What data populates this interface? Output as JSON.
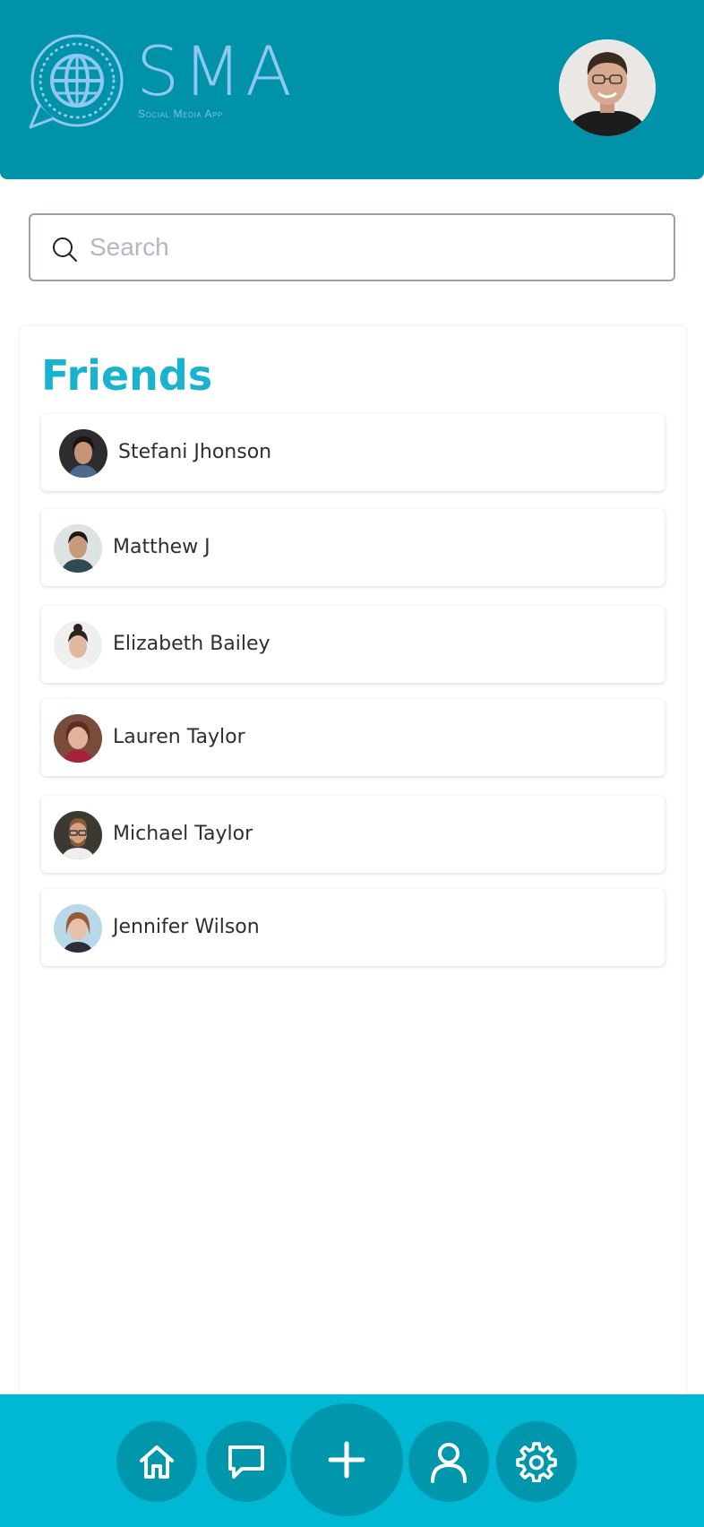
{
  "header": {
    "logo_title": "SMA",
    "logo_subtitle": "Social Media App",
    "profile_icon": "user-avatar"
  },
  "search": {
    "placeholder": "Search",
    "icon": "search-icon"
  },
  "friends": {
    "title": "Friends",
    "items": [
      {
        "name": "Stefani Jhonson"
      },
      {
        "name": "Matthew J"
      },
      {
        "name": "Elizabeth Bailey"
      },
      {
        "name": "Lauren Taylor"
      },
      {
        "name": "Michael Taylor"
      },
      {
        "name": "Jennifer Wilson"
      }
    ]
  },
  "nav": {
    "items": [
      {
        "icon": "home-icon"
      },
      {
        "icon": "chat-icon"
      },
      {
        "icon": "plus-icon"
      },
      {
        "icon": "user-icon"
      },
      {
        "icon": "gear-icon"
      }
    ]
  },
  "colors": {
    "header_bg": "#0092a8",
    "accent": "#1ab3cf",
    "nav_bg": "#00b8d4",
    "nav_button": "#0097ad",
    "logo": "#8ec7f0"
  }
}
